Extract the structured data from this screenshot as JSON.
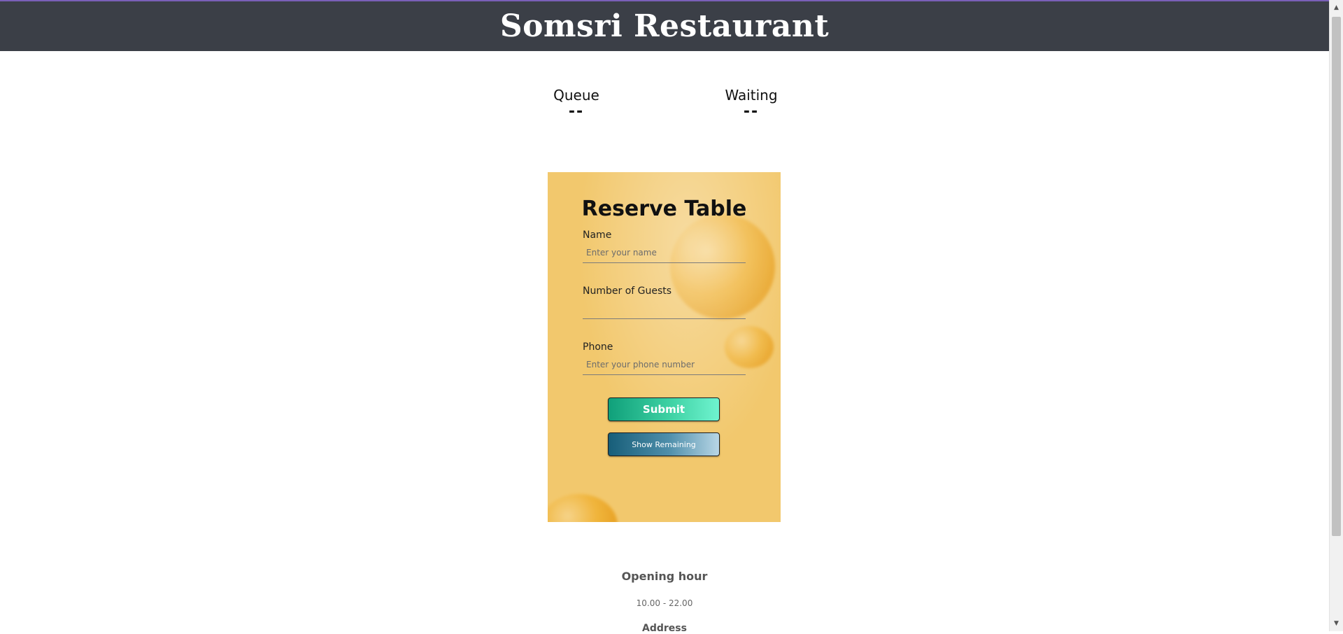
{
  "header": {
    "title": "Somsri Restaurant"
  },
  "stats": {
    "queue": {
      "label": "Queue",
      "value": "--"
    },
    "waiting": {
      "label": "Waiting",
      "value": "--"
    }
  },
  "form": {
    "title": "Reserve Table",
    "name": {
      "label": "Name",
      "placeholder": "Enter your name",
      "value": ""
    },
    "guests": {
      "label": "Number of Guests",
      "placeholder": "",
      "value": ""
    },
    "phone": {
      "label": "Phone",
      "placeholder": "Enter your phone number",
      "value": ""
    },
    "submit_label": "Submit",
    "show_remaining_label": "Show Remaining"
  },
  "info": {
    "opening_heading": "Opening hour",
    "opening_hours": "10.00 - 22.00",
    "address_heading": "Address"
  },
  "scrollbar": {
    "up_icon": "▲",
    "down_icon": "▼"
  },
  "colors": {
    "header_bg": "#3b3f47",
    "accent_line": "#7a5fb8",
    "card_bg": "#f2c86d",
    "submit_from": "#10a07a",
    "submit_to": "#6ff3cf",
    "remaining_from": "#175e79",
    "remaining_to": "#b8d6e6"
  }
}
